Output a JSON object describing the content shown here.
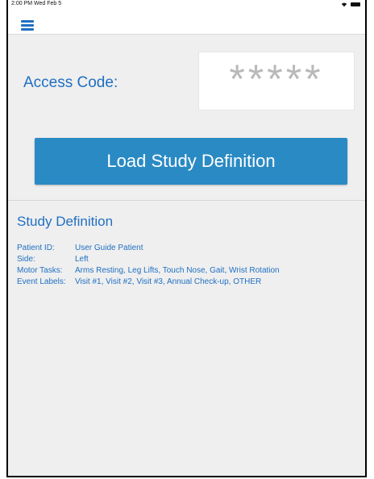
{
  "status": {
    "time": "2:00 PM  Wed Feb 5"
  },
  "access": {
    "label": "Access Code:",
    "code_display": "*****"
  },
  "load_button": {
    "label": "Load Study Definition"
  },
  "study": {
    "title": "Study Definition",
    "rows": [
      {
        "key": "Patient ID:",
        "value": "User Guide Patient"
      },
      {
        "key": "Side:",
        "value": "Left"
      },
      {
        "key": "Motor Tasks:",
        "value": "Arms Resting, Leg Lifts, Touch Nose, Gait, Wrist Rotation"
      },
      {
        "key": "Event Labels:",
        "value": "Visit #1, Visit #2, Visit #3, Annual Check-up, OTHER"
      }
    ]
  },
  "colors": {
    "accent": "#1f6fc2",
    "button": "#2a8ac4",
    "background": "#efefef"
  },
  "icons": {
    "menu": "hamburger-menu-icon",
    "wifi": "wifi-icon",
    "battery": "battery-icon"
  }
}
